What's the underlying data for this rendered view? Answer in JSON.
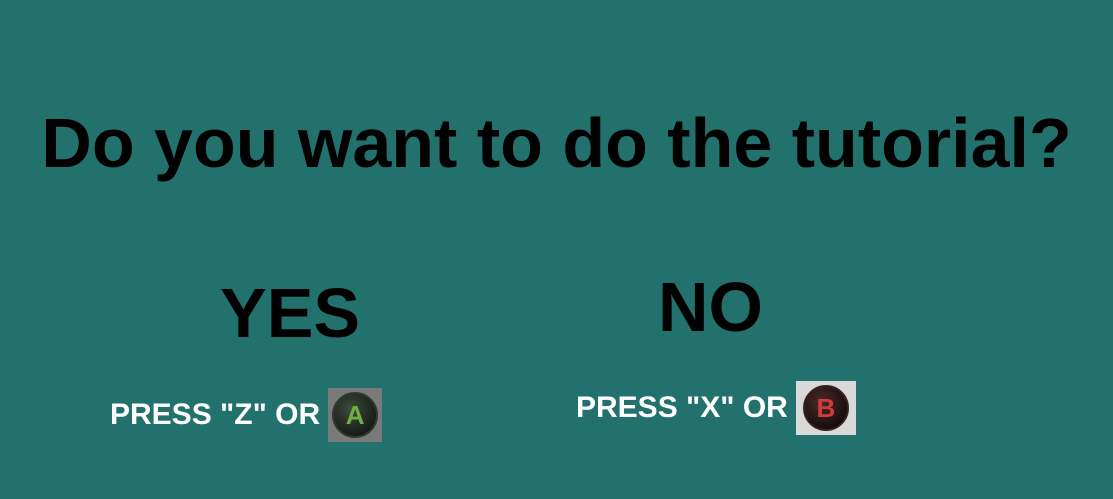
{
  "prompt": {
    "title": "Do you want to do the tutorial?"
  },
  "options": {
    "yes": {
      "label": "YES",
      "instruction": "PRESS \"Z\" OR",
      "button_letter": "A",
      "button_icon": "xbox-a-button-icon",
      "button_color": "#6fae3f"
    },
    "no": {
      "label": "NO",
      "instruction": "PRESS \"X\" OR",
      "button_letter": "B",
      "button_icon": "xbox-b-button-icon",
      "button_color": "#d23a3a"
    }
  },
  "colors": {
    "background": "#23716d",
    "title_text": "#000000",
    "instruction_text": "#ffffff"
  }
}
